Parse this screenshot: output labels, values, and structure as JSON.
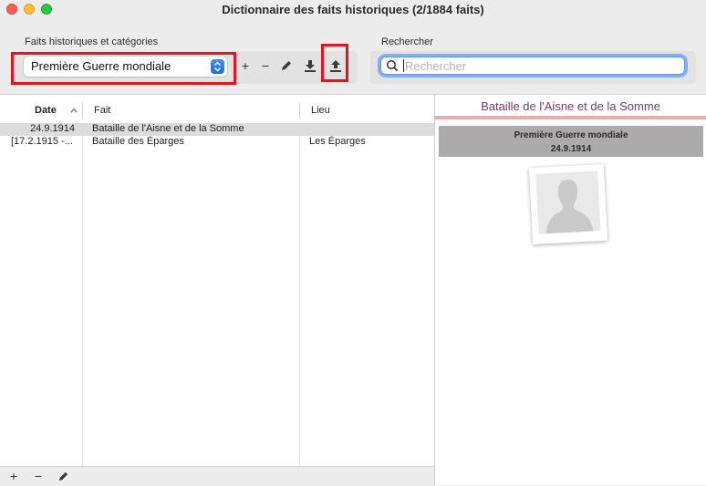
{
  "window": {
    "title": "Dictionnaire des faits historiques (2/1884 faits)"
  },
  "toolbar": {
    "category_label": "Faits historiques et catégories",
    "category_selected": "Première Guerre mondiale",
    "add_label": "+",
    "remove_label": "−",
    "search_label": "Rechercher",
    "search_placeholder": "Rechercher"
  },
  "table": {
    "columns": [
      "Date",
      "Fait",
      "Lieu"
    ],
    "rows": [
      {
        "date": "24.9.1914",
        "fait": "Bataille de l'Aisne et de la Somme",
        "lieu": ""
      },
      {
        "date": "[17.2.1915 -...",
        "fait": "Bataille des Éparges",
        "lieu": "Les Éparges"
      }
    ]
  },
  "bottom_bar": {
    "add_label": "+",
    "remove_label": "−"
  },
  "detail": {
    "title": "Bataille de l'Aisne et de la Somme",
    "category": "Première Guerre mondiale",
    "date": "24.9.1914"
  },
  "icons": {
    "pencil": "pencil-icon",
    "import": "import-icon",
    "export": "export-icon",
    "search": "search-icon",
    "sort": "sort-ascending-icon",
    "placeholder": "person-placeholder-icon"
  },
  "colors": {
    "highlight_box": "#e3141f",
    "detail_title": "#7a3a6d",
    "accent_bar": "#f0a8a8",
    "focus_ring": "#7fb0f5"
  }
}
